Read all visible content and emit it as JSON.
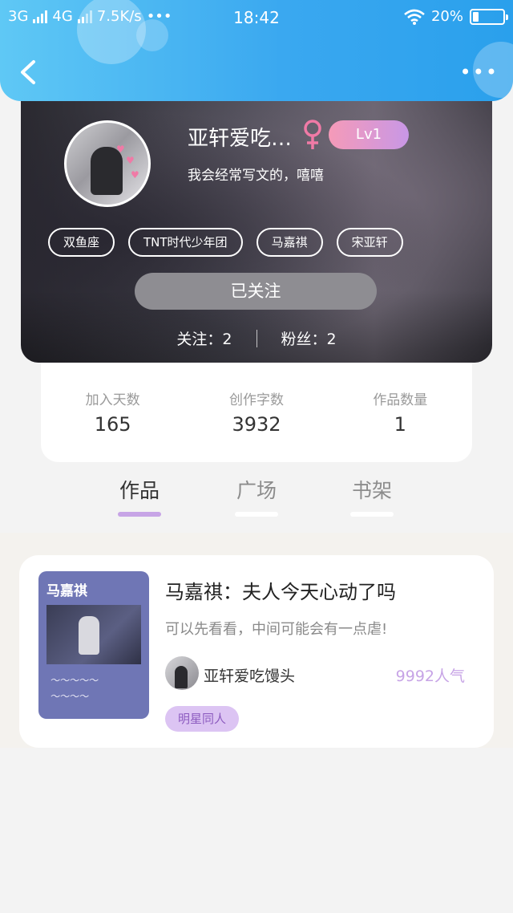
{
  "status_bar": {
    "network1": "3G",
    "network2": "4G",
    "speed": "7.5K/s",
    "time": "18:42",
    "battery": "20%",
    "battery_level": 0.2
  },
  "nav": {
    "back_icon": "chevron-left-icon",
    "more_icon": "more-dots-icon"
  },
  "profile": {
    "nickname": "亚轩爱吃…",
    "gender_icon": "female-icon",
    "level": "Lv1",
    "bio": "我会经常写文的，嘻嘻",
    "tags": [
      "双鱼座",
      "TNT时代少年团",
      "马嘉祺",
      "宋亚轩"
    ],
    "follow_button": "已关注",
    "following": "关注：2",
    "followers": "粉丝：2"
  },
  "stats": [
    {
      "label": "加入天数",
      "value": "165"
    },
    {
      "label": "创作字数",
      "value": "3932"
    },
    {
      "label": "作品数量",
      "value": "1"
    }
  ],
  "tabs": [
    {
      "label": "作品",
      "active": true
    },
    {
      "label": "广场",
      "active": false
    },
    {
      "label": "书架",
      "active": false
    }
  ],
  "works": [
    {
      "cover_title": "马嘉祺",
      "title": "马嘉祺：夫人今天心动了吗",
      "description": "可以先看看，中间可能会有一点虐!",
      "author": "亚轩爱吃馒头",
      "popularity": "9992人气",
      "category": "明星同人"
    }
  ],
  "colors": {
    "header_blue": "#3aa8f0",
    "accent_purple": "#c7a4e6",
    "level_pink": "#f59ab8"
  }
}
